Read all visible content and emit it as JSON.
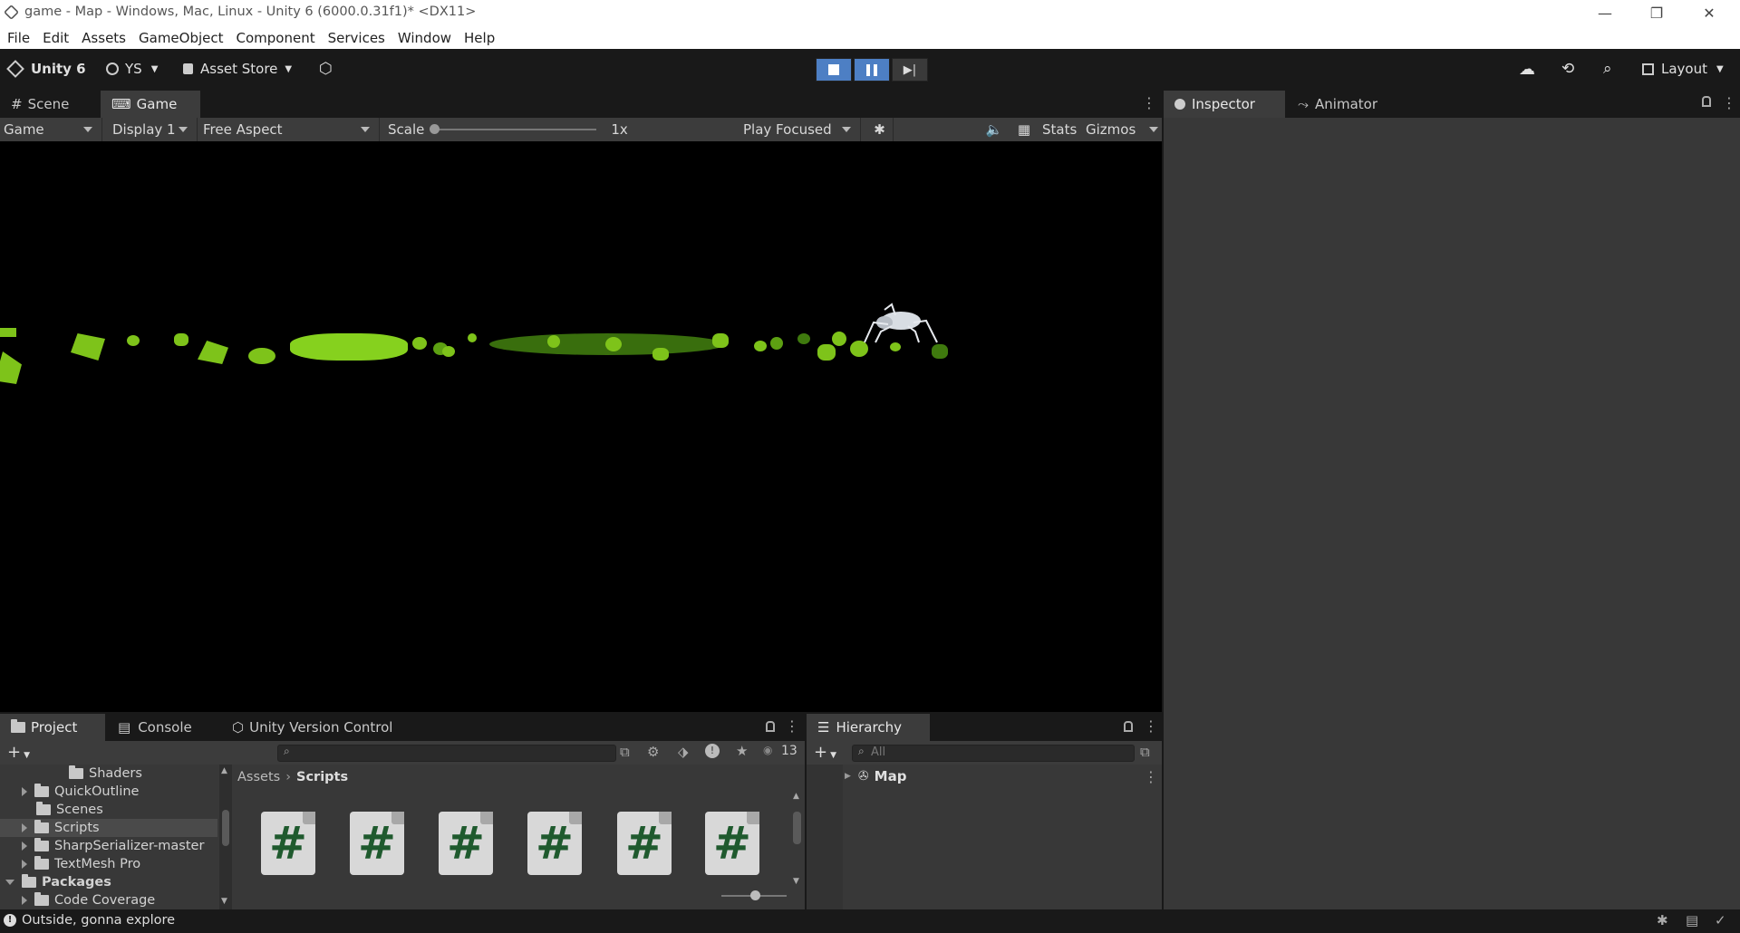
{
  "titlebar": {
    "title": "game - Map - Windows, Mac, Linux - Unity 6 (6000.0.31f1)* <DX11>"
  },
  "menu": [
    "File",
    "Edit",
    "Assets",
    "GameObject",
    "Component",
    "Services",
    "Window",
    "Help"
  ],
  "toolbar": {
    "unity": "Unity 6",
    "account": "YS",
    "asset_store": "Asset Store",
    "layout": "Layout"
  },
  "tabs": {
    "scene": "Scene",
    "game": "Game",
    "inspector": "Inspector",
    "animator": "Animator"
  },
  "game_toolbar": {
    "mode": "Game",
    "display": "Display 1",
    "aspect": "Free Aspect",
    "scale_label": "Scale",
    "scale_value": "1x",
    "play_focused": "Play Focused",
    "stats": "Stats",
    "gizmos": "Gizmos"
  },
  "bottom_tabs": {
    "project": "Project",
    "console": "Console",
    "uvc": "Unity Version Control",
    "hierarchy": "Hierarchy"
  },
  "project": {
    "visible_count": "13",
    "breadcrumb": [
      "Assets",
      "Scripts"
    ],
    "tree": [
      {
        "label": "Shaders",
        "expand": false
      },
      {
        "label": "QuickOutline",
        "expand": true
      },
      {
        "label": "Scenes",
        "expand": false
      },
      {
        "label": "Scripts",
        "expand": true,
        "selected": true
      },
      {
        "label": "SharpSerializer-master",
        "expand": true
      },
      {
        "label": "TextMesh Pro",
        "expand": true
      },
      {
        "label": "Packages",
        "expand": true,
        "open": true
      },
      {
        "label": "Code Coverage",
        "expand": true
      }
    ],
    "script_glyph": "#"
  },
  "hierarchy": {
    "search_placeholder": "All",
    "root": "Map"
  },
  "status": {
    "message": "Outside, gonna explore"
  },
  "colors": {
    "accent": "#4d7fc4",
    "leaf": "#7ec31a",
    "scene_bg": "#000000",
    "panel": "#383838"
  }
}
